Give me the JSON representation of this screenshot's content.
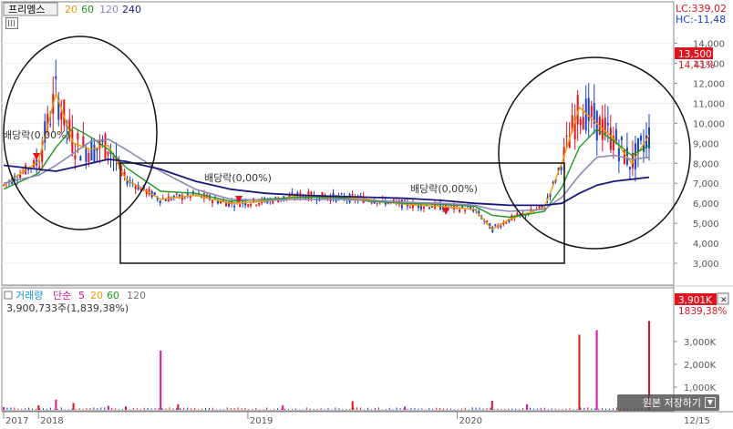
{
  "price_panel": {
    "symbol": "프리엠스",
    "ma_labels": [
      {
        "label": "20",
        "color": "#f29a00"
      },
      {
        "label": "60",
        "color": "#1f9a1f"
      },
      {
        "label": "120",
        "color": "#8a8ab5"
      },
      {
        "label": "240",
        "color": "#1a1a7a"
      }
    ],
    "lc_label": "LC:339,02",
    "hc_label": "HC:-11,48",
    "current_price": "13,500",
    "current_change": "14,41%",
    "dividend_label": "배당락(0,00%)"
  },
  "volume_panel": {
    "title": "거래량",
    "sma_label": "단순",
    "ma_labels": [
      {
        "label": "5",
        "color": "#d4149a"
      },
      {
        "label": "20",
        "color": "#f29a00"
      },
      {
        "label": "60",
        "color": "#1f9a1f"
      },
      {
        "label": "120",
        "color": "#777777"
      }
    ],
    "info": "3,900,733주(1,839,38%)",
    "current_volume": "3,901K",
    "current_pct": "1839,38%"
  },
  "x_axis": {
    "labels": [
      "2017",
      "2018",
      "2019",
      "2020",
      "12/15"
    ]
  },
  "save_button": {
    "label": "원본 저장하기"
  },
  "colors": {
    "up": "#e0141e",
    "down": "#1840c8",
    "ma20": "#f29a00",
    "ma60": "#1f9a1f",
    "ma120": "#8a8ab5",
    "ma240": "#1a1a7a",
    "vol_ma5": "#d4149a"
  },
  "chart_data": [
    {
      "type": "line",
      "title": "프리엠스",
      "ylim": [
        2500,
        14800
      ],
      "y_ticks": [
        "3,000",
        "4,000",
        "5,000",
        "6,000",
        "7,000",
        "8,000",
        "9,000",
        "10,000",
        "11,000",
        "12,000",
        "13,000",
        "14,000"
      ],
      "y_tick_values": [
        3000,
        4000,
        5000,
        6000,
        7000,
        8000,
        9000,
        10000,
        11000,
        12000,
        13000,
        14000
      ],
      "x": [
        "2017-11",
        "2018-01",
        "2018-02",
        "2018-03",
        "2018-04",
        "2018-05",
        "2018-06",
        "2018-08",
        "2018-10",
        "2018-12",
        "2019-02",
        "2019-04",
        "2019-06",
        "2019-08",
        "2019-10",
        "2019-12",
        "2020-02",
        "2020-03",
        "2020-04",
        "2020-06",
        "2020-07",
        "2020-08",
        "2020-09",
        "2020-10",
        "2020-11",
        "2020-12"
      ],
      "series": [
        {
          "name": "20",
          "values": [
            6900,
            8100,
            11500,
            9000,
            8700,
            8900,
            7200,
            6200,
            6400,
            6000,
            6100,
            6400,
            6300,
            6200,
            5950,
            5850,
            5700,
            4700,
            5200,
            5800,
            8000,
            10800,
            10000,
            9200,
            8000,
            9400
          ]
        },
        {
          "name": "60",
          "values": [
            6700,
            7500,
            8800,
            9800,
            9300,
            8700,
            7800,
            6600,
            6500,
            6100,
            6200,
            6300,
            6300,
            6100,
            6000,
            5950,
            5850,
            5400,
            5300,
            5600,
            6800,
            8800,
            9700,
            9100,
            8400,
            8900
          ]
        },
        {
          "name": "120",
          "values": [
            7000,
            7400,
            7900,
            8500,
            9100,
            9200,
            8700,
            7600,
            6700,
            6200,
            6150,
            6200,
            6200,
            6150,
            6050,
            6000,
            5900,
            5700,
            5600,
            5700,
            6300,
            7400,
            8300,
            8400,
            8200,
            8300
          ]
        },
        {
          "name": "240",
          "values": [
            7900,
            7700,
            7600,
            7800,
            8000,
            8200,
            8100,
            7700,
            7100,
            6700,
            6500,
            6400,
            6350,
            6300,
            6250,
            6150,
            6000,
            5950,
            5900,
            5900,
            6000,
            6500,
            6900,
            7100,
            7200,
            7300
          ]
        }
      ],
      "annotations": [
        "배당락(0,00%)",
        "배당락(0,00%)",
        "배당락(0,00%)"
      ]
    },
    {
      "type": "bar",
      "title": "거래량",
      "ylim": [
        0,
        4000
      ],
      "y_ticks": [
        "1,000K",
        "2,000K",
        "3,000K"
      ],
      "y_tick_values": [
        1000,
        2000,
        3000
      ],
      "x": [
        "2017-11",
        "2018-01",
        "2018-02",
        "2018-03",
        "2018-05",
        "2018-06",
        "2018-08",
        "2018-09",
        "2019-03",
        "2019-07",
        "2019-10",
        "2020-03",
        "2020-05",
        "2020-08",
        "2020-09",
        "2020-12"
      ],
      "values": [
        120,
        200,
        450,
        300,
        180,
        150,
        2600,
        250,
        200,
        380,
        150,
        400,
        250,
        3300,
        3500,
        3901
      ]
    }
  ]
}
